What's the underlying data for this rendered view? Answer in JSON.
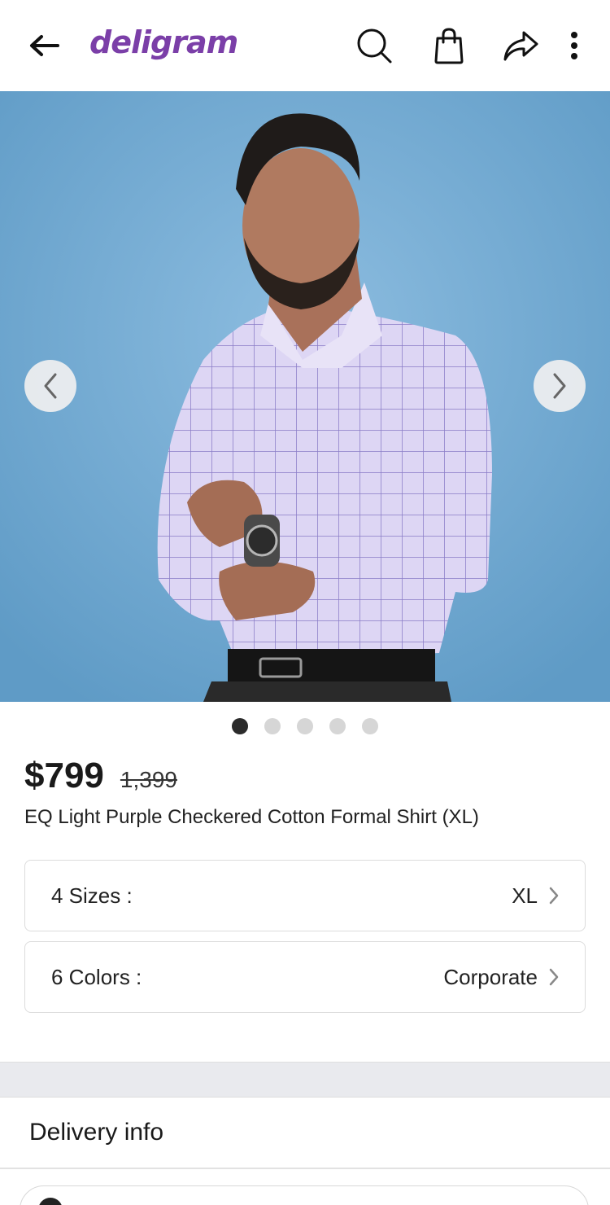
{
  "header": {
    "logo_text": "deligram",
    "icons": [
      "back-arrow-icon",
      "search-icon",
      "shopping-bag-icon",
      "share-icon",
      "more-vertical-icon"
    ],
    "brand_color": "#7b3fa8"
  },
  "gallery": {
    "image_count": 5,
    "active_index": 0,
    "background_color": "#79acd0"
  },
  "product": {
    "price": "$799",
    "old_price": "1,399",
    "title": "EQ Light Purple Checkered Cotton Formal Shirt (XL)"
  },
  "options": {
    "sizes_label": "4 Sizes :",
    "sizes_value": "XL",
    "colors_label": "6 Colors :",
    "colors_value": "Corporate"
  },
  "delivery": {
    "heading": "Delivery info"
  }
}
